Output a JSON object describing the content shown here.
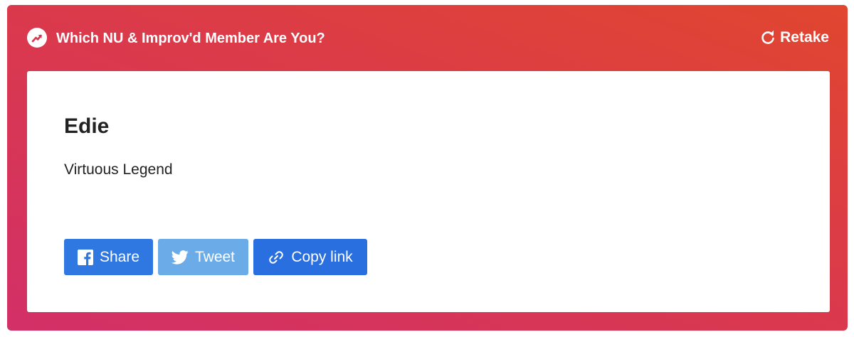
{
  "quiz": {
    "title": "Which NU & Improv'd Member Are You?",
    "retake_label": "Retake"
  },
  "result": {
    "name": "Edie",
    "description": "Virtuous Legend"
  },
  "share": {
    "facebook_label": "Share",
    "twitter_label": "Tweet",
    "copy_label": "Copy link"
  },
  "colors": {
    "gradient_start": "#d23068",
    "gradient_end": "#e0462f",
    "facebook_blue": "#2f78e2",
    "twitter_blue": "#6aabe8",
    "copy_blue": "#2a6fe0"
  },
  "icons": {
    "badge": "trending-arrow-icon",
    "retake": "refresh-icon",
    "facebook": "facebook-icon",
    "twitter": "twitter-icon",
    "copy": "link-icon"
  }
}
